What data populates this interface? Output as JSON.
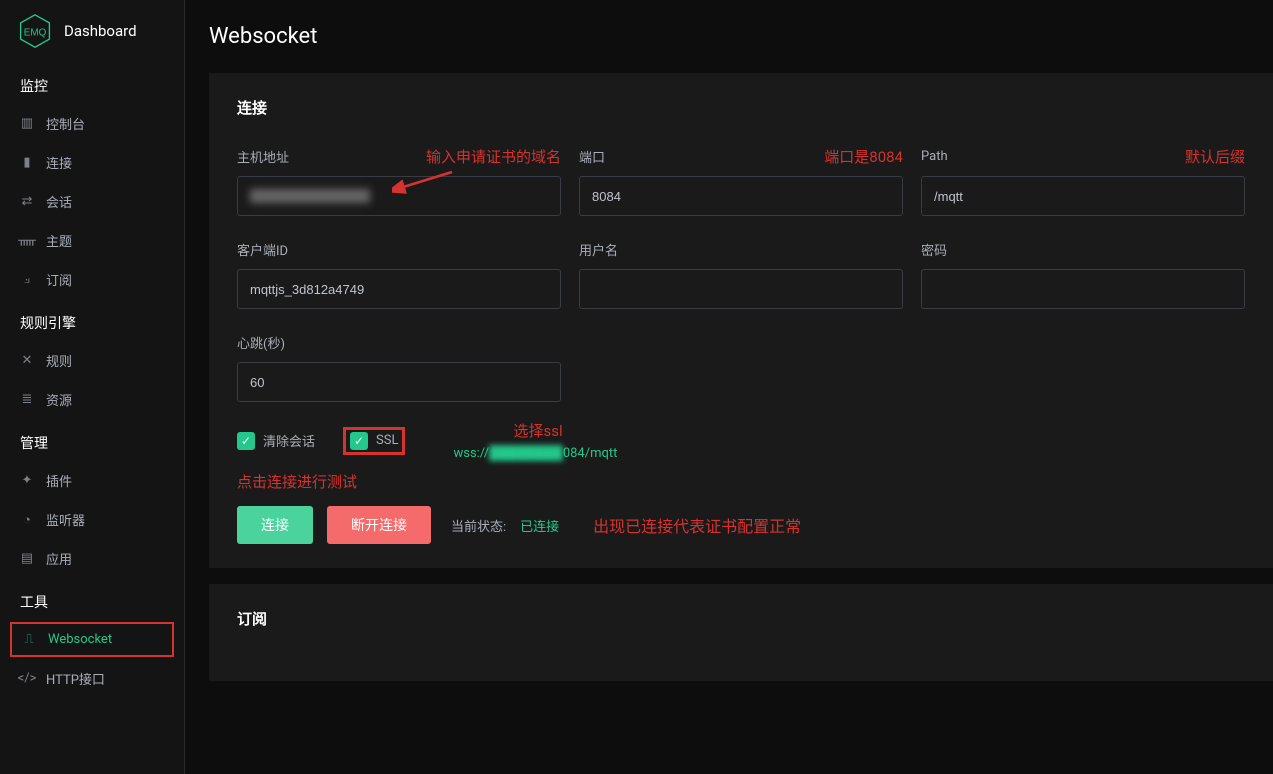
{
  "logo": {
    "text": "EMQ",
    "dashboard": "Dashboard"
  },
  "nav": {
    "group_monitor": "监控",
    "items_monitor": [
      {
        "icon": "bar-chart-icon",
        "label": "控制台"
      },
      {
        "icon": "connection-icon",
        "label": "连接"
      },
      {
        "icon": "swap-icon",
        "label": "会话"
      },
      {
        "icon": "topic-icon",
        "label": "主题"
      },
      {
        "icon": "rss-icon",
        "label": "订阅"
      }
    ],
    "group_rule": "规则引擎",
    "items_rule": [
      {
        "icon": "shuffle-icon",
        "label": "规则"
      },
      {
        "icon": "list-icon",
        "label": "资源"
      }
    ],
    "group_manage": "管理",
    "items_manage": [
      {
        "icon": "plug-icon",
        "label": "插件"
      },
      {
        "icon": "listener-icon",
        "label": "监听器"
      },
      {
        "icon": "app-icon",
        "label": "应用"
      }
    ],
    "group_tools": "工具",
    "items_tools": [
      {
        "icon": "websocket-icon",
        "label": "Websocket",
        "active": true
      },
      {
        "icon": "code-icon",
        "label": "HTTP接口"
      }
    ]
  },
  "page": {
    "title": "Websocket"
  },
  "connect": {
    "title": "连接",
    "host_label": "主机地址",
    "host_annot": "输入申请证书的域名",
    "host_value": "",
    "port_label": "端口",
    "port_annot": "端口是8084",
    "port_value": "8084",
    "path_label": "Path",
    "path_annot": "默认后缀",
    "path_value": "/mqtt",
    "clientid_label": "客户端ID",
    "clientid_value": "mqttjs_3d812a4749",
    "user_label": "用户名",
    "user_value": "",
    "pass_label": "密码",
    "pass_value": "",
    "heartbeat_label": "心跳(秒)",
    "heartbeat_value": "60",
    "clean_label": "清除会话",
    "ssl_label": "SSL",
    "ssl_annot": "选择ssl",
    "url_prefix": "wss://",
    "url_suffix": "084/mqtt",
    "click_annot": "点击连接进行测试",
    "btn_connect": "连接",
    "btn_disconnect": "断开连接",
    "status_label": "当前状态:",
    "status_value": "已连接",
    "status_annot": "出现已连接代表证书配置正常"
  },
  "subscribe": {
    "title": "订阅"
  }
}
